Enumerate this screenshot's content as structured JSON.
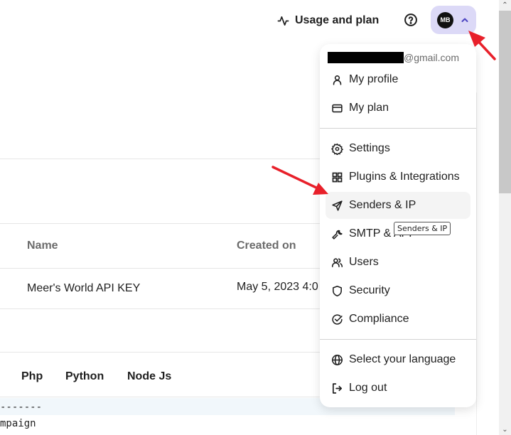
{
  "header": {
    "usage_label": "Usage and plan",
    "help_icon": "question-circle-icon",
    "avatar_initials": "MB",
    "account_chevron": "chevron-up-icon",
    "accent_color": "#dcd9f7"
  },
  "main": {
    "table": {
      "columns": [
        "Name",
        "Created on"
      ],
      "rows": [
        {
          "name": "Meer's World API KEY",
          "created_on": "May 5, 2023 4:0"
        }
      ]
    },
    "code_tabs": [
      "Php",
      "Python",
      "Node Js"
    ],
    "code_lines": [
      "-------",
      "mpaign"
    ]
  },
  "account_menu": {
    "email_suffix": "@gmail.com",
    "email_redacted": true,
    "items": [
      {
        "label": "My profile",
        "icon": "user-icon"
      },
      {
        "label": "My plan",
        "icon": "credit-card-icon"
      },
      {
        "label": "Settings",
        "icon": "gear-icon"
      },
      {
        "label": "Plugins & Integrations",
        "icon": "grid-icon"
      },
      {
        "label": "Senders & IP",
        "icon": "send-icon",
        "hovered": true
      },
      {
        "label": "SMTP & API",
        "icon": "wrench-icon"
      },
      {
        "label": "Users",
        "icon": "users-icon"
      },
      {
        "label": "Security",
        "icon": "shield-icon"
      },
      {
        "label": "Compliance",
        "icon": "check-circle-icon"
      },
      {
        "label": "Select your language",
        "icon": "globe-icon"
      },
      {
        "label": "Log out",
        "icon": "logout-icon"
      }
    ],
    "tooltip": "Senders & IP"
  },
  "annotations": {
    "arrow_color": "#e8202a"
  }
}
